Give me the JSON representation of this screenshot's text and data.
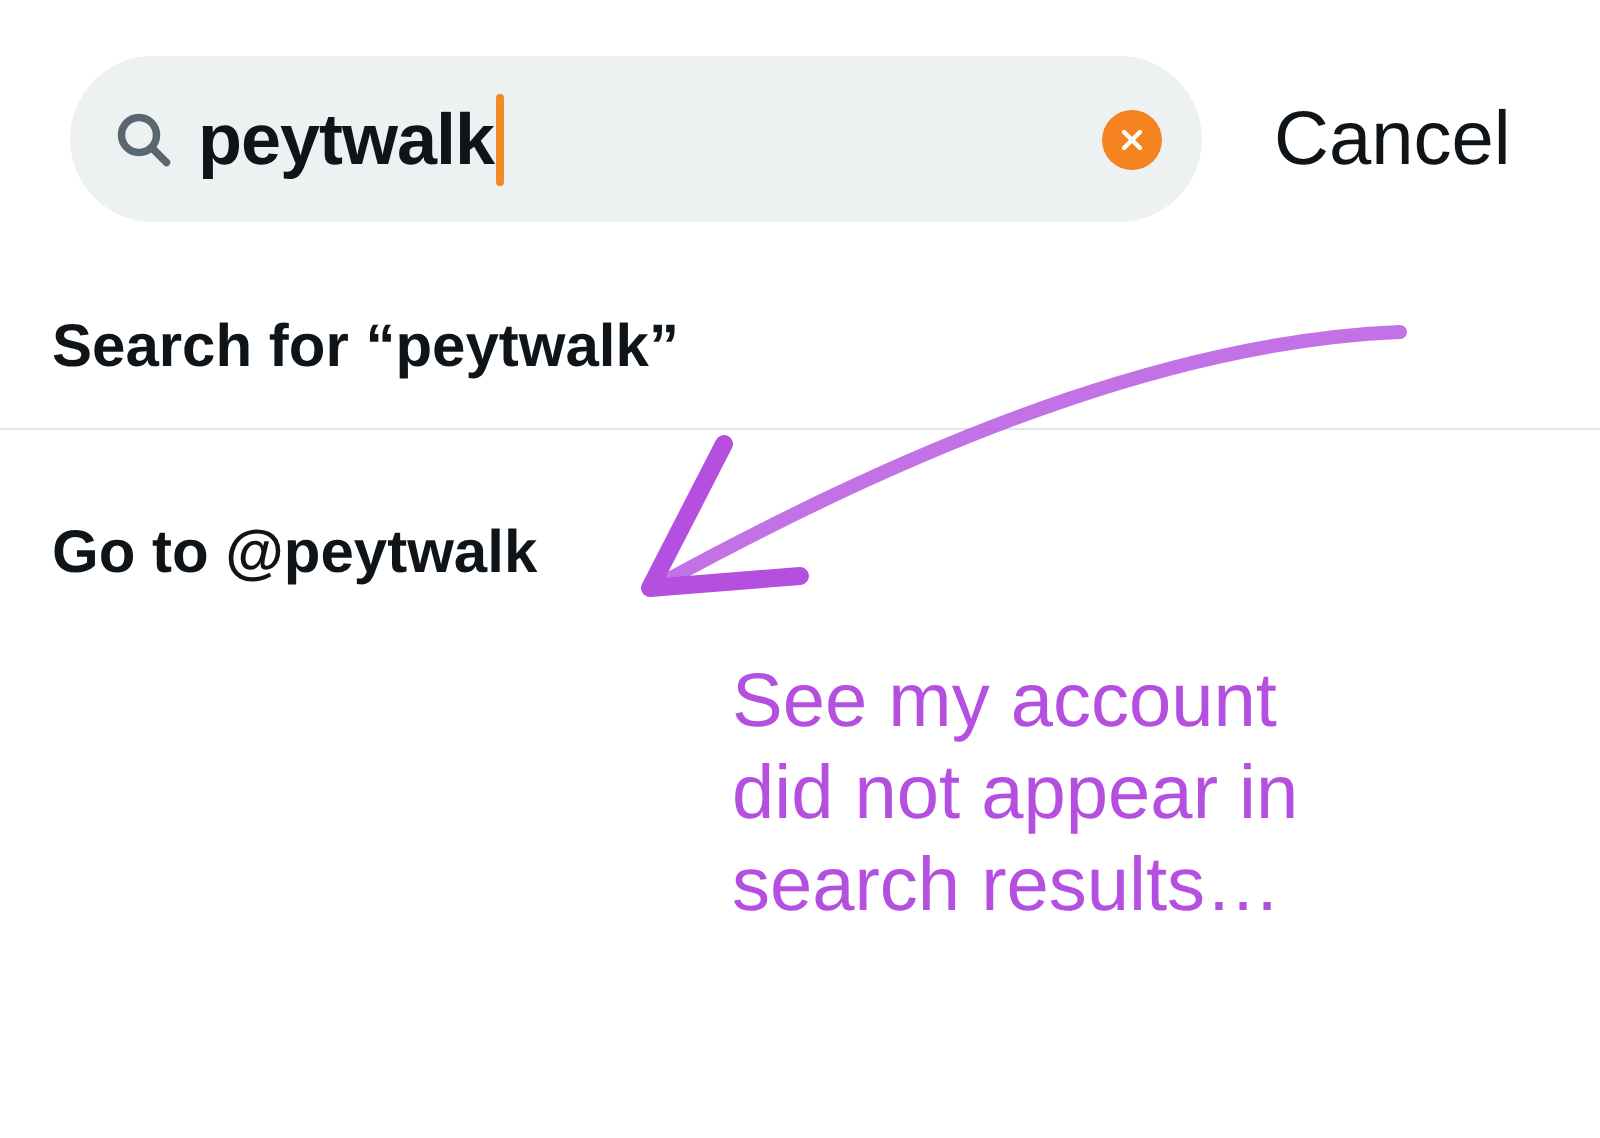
{
  "search": {
    "value": "peytwalk"
  },
  "cancel": "Cancel",
  "results": [
    {
      "label": "Search for “peytwalk”"
    },
    {
      "label": "Go to @peytwalk"
    }
  ],
  "annotation": {
    "text": "See my account\ndid not appear in\nsearch results…"
  }
}
